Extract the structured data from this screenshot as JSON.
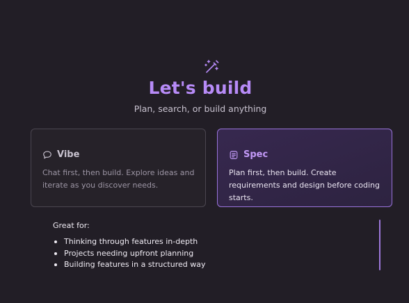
{
  "hero": {
    "icon": "magic-wand-sparkle-icon",
    "title": "Let's build",
    "subtitle": "Plan, search, or build anything"
  },
  "modes": [
    {
      "icon": "chat-bubble-icon",
      "title": "Vibe",
      "description": "Chat first, then build. Explore ideas and iterate as you discover needs.",
      "selected": false
    },
    {
      "icon": "spec-document-icon",
      "title": "Spec",
      "description": "Plan first, then build. Create requirements and design before coding starts.",
      "selected": true
    }
  ],
  "details": {
    "label": "Great for:",
    "items": [
      "Thinking through features in-depth",
      "Projects needing upfront planning",
      "Building features in a structured way"
    ]
  },
  "colors": {
    "background": "#221e26",
    "accent": "#b78bf7",
    "selected_border": "#9a74dc"
  }
}
